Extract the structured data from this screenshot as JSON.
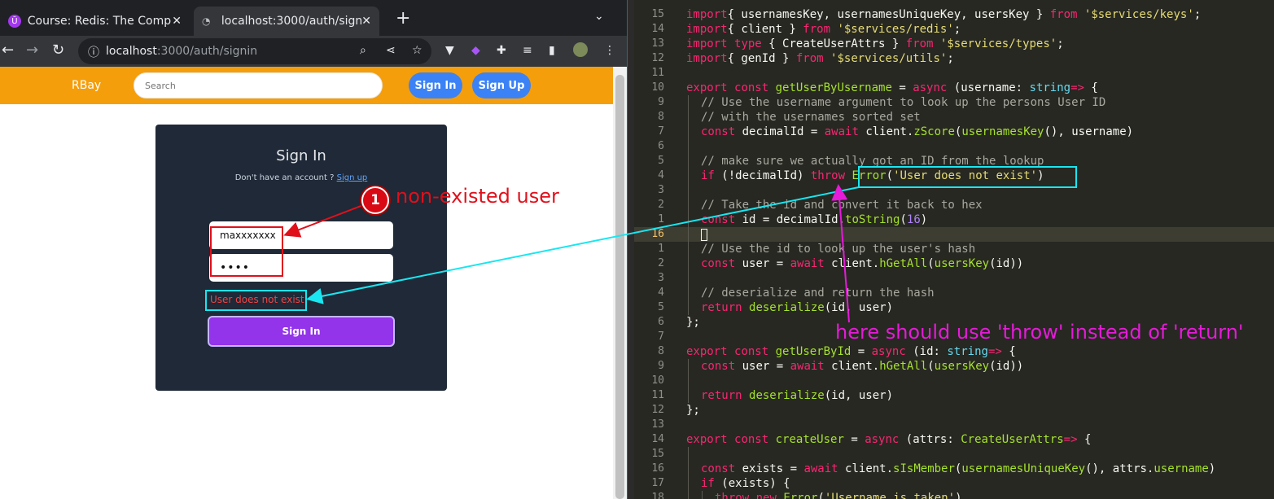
{
  "browser": {
    "tabs": [
      {
        "title": "Course: Redis: The Compl",
        "favicon": "udemy-icon"
      },
      {
        "title": "localhost:3000/auth/sign",
        "favicon": "page-icon"
      }
    ],
    "address": {
      "host": "localhost",
      "path": ":3000/auth/signin"
    }
  },
  "app": {
    "brand": "RBay",
    "search_placeholder": "Search",
    "nav_signin": "Sign In",
    "nav_signup": "Sign Up",
    "form": {
      "title": "Sign In",
      "subtitle": "Don't have an account ?",
      "subtitle_link": "Sign up",
      "username_value": "maxxxxxxx",
      "password_value": "••••",
      "error": "User does not exist",
      "submit_label": "Sign In"
    }
  },
  "editor": {
    "current_line": 16,
    "lines": [
      {
        "n": "15",
        "indent": 0,
        "tokens": [
          [
            "kw",
            "import"
          ],
          [
            "",
            "{ usernamesKey, usernamesUniqueKey, usersKey } "
          ],
          [
            "kw",
            "from"
          ],
          [
            "",
            " "
          ],
          [
            "st",
            "'$services/keys'"
          ],
          [
            "",
            ";"
          ]
        ]
      },
      {
        "n": "14",
        "indent": 0,
        "tokens": [
          [
            "kw",
            "import"
          ],
          [
            "",
            "{ client } "
          ],
          [
            "kw",
            "from"
          ],
          [
            "",
            " "
          ],
          [
            "st",
            "'$services/redis'"
          ],
          [
            "",
            ";"
          ]
        ]
      },
      {
        "n": "13",
        "indent": 0,
        "tokens": [
          [
            "kw",
            "import"
          ],
          [
            "",
            " "
          ],
          [
            "kw",
            "type"
          ],
          [
            "",
            " { "
          ],
          [
            "",
            "CreateUserAttrs"
          ],
          [
            "",
            " } "
          ],
          [
            "kw",
            "from"
          ],
          [
            "",
            " "
          ],
          [
            "st",
            "'$services/types'"
          ],
          [
            "",
            ";"
          ]
        ]
      },
      {
        "n": "12",
        "indent": 0,
        "tokens": [
          [
            "kw",
            "import"
          ],
          [
            "",
            "{ genId } "
          ],
          [
            "kw",
            "from"
          ],
          [
            "",
            " "
          ],
          [
            "st",
            "'$services/utils'"
          ],
          [
            "",
            ";"
          ]
        ]
      },
      {
        "n": "11",
        "indent": 0,
        "tokens": []
      },
      {
        "n": "10",
        "indent": 0,
        "tokens": [
          [
            "kw",
            "export"
          ],
          [
            "",
            " "
          ],
          [
            "kw",
            "const"
          ],
          [
            "",
            " "
          ],
          [
            "fn",
            "getUserByUsername"
          ],
          [
            "",
            " = "
          ],
          [
            "kw",
            "async"
          ],
          [
            "",
            " (username: "
          ],
          [
            "ty",
            "string"
          ],
          [
            ") "
          ],
          [
            "kw",
            "=>"
          ],
          [
            "",
            " {"
          ]
        ]
      },
      {
        "n": "9",
        "indent": 1,
        "tokens": [
          [
            "cm",
            "// Use the username argument to look up the persons User ID"
          ]
        ]
      },
      {
        "n": "8",
        "indent": 1,
        "tokens": [
          [
            "cm",
            "// with the usernames sorted set"
          ]
        ]
      },
      {
        "n": "7",
        "indent": 1,
        "tokens": [
          [
            "kw",
            "const"
          ],
          [
            "",
            " decimalId = "
          ],
          [
            "kw",
            "await"
          ],
          [
            "",
            " client."
          ],
          [
            "fn",
            "zScore"
          ],
          [
            "",
            "("
          ],
          [
            "fn",
            "usernamesKey"
          ],
          [
            "",
            "(), username)"
          ]
        ]
      },
      {
        "n": "6",
        "indent": 1,
        "tokens": []
      },
      {
        "n": "5",
        "indent": 1,
        "tokens": [
          [
            "cm",
            "// make sure we actually got an ID from the lookup"
          ]
        ]
      },
      {
        "n": "4",
        "indent": 1,
        "tokens": [
          [
            "kw",
            "if"
          ],
          [
            "",
            " (!decimalId) "
          ],
          [
            "kw",
            "throw"
          ],
          [
            "",
            " "
          ],
          [
            "fn",
            "Error"
          ],
          [
            "",
            "("
          ],
          [
            "st",
            "'User does not exist'"
          ],
          [
            "",
            ")"
          ]
        ]
      },
      {
        "n": "3",
        "indent": 1,
        "tokens": []
      },
      {
        "n": "2",
        "indent": 1,
        "tokens": [
          [
            "cm",
            "// Take the id and convert it back to hex"
          ]
        ]
      },
      {
        "n": "1",
        "indent": 1,
        "tokens": [
          [
            "kw",
            "const"
          ],
          [
            "",
            " id = decimalId."
          ],
          [
            "fn",
            "toString"
          ],
          [
            "",
            "("
          ],
          [
            "nu",
            "16"
          ],
          [
            "",
            ")"
          ]
        ]
      },
      {
        "n": "16",
        "indent": 1,
        "tokens": []
      },
      {
        "n": "1",
        "indent": 1,
        "tokens": [
          [
            "cm",
            "// Use the id to look up the user's hash"
          ]
        ]
      },
      {
        "n": "2",
        "indent": 1,
        "tokens": [
          [
            "kw",
            "const"
          ],
          [
            "",
            " user = "
          ],
          [
            "kw",
            "await"
          ],
          [
            "",
            " client."
          ],
          [
            "fn",
            "hGetAll"
          ],
          [
            "",
            "("
          ],
          [
            "fn",
            "usersKey"
          ],
          [
            "",
            "(id))"
          ]
        ]
      },
      {
        "n": "3",
        "indent": 1,
        "tokens": []
      },
      {
        "n": "4",
        "indent": 1,
        "tokens": [
          [
            "cm",
            "// deserialize and return the hash"
          ]
        ]
      },
      {
        "n": "5",
        "indent": 1,
        "tokens": [
          [
            "kw",
            "return"
          ],
          [
            "",
            " "
          ],
          [
            "fn",
            "deserialize"
          ],
          [
            "",
            "(id, user)"
          ]
        ]
      },
      {
        "n": "6",
        "indent": 0,
        "tokens": [
          [
            "",
            "};"
          ]
        ]
      },
      {
        "n": "7",
        "indent": 0,
        "tokens": []
      },
      {
        "n": "8",
        "indent": 0,
        "tokens": [
          [
            "kw",
            "export"
          ],
          [
            "",
            " "
          ],
          [
            "kw",
            "const"
          ],
          [
            "",
            " "
          ],
          [
            "fn",
            "getUserById"
          ],
          [
            "",
            " = "
          ],
          [
            "kw",
            "async"
          ],
          [
            "",
            " (id: "
          ],
          [
            "ty",
            "string"
          ],
          [
            ") "
          ],
          [
            "kw",
            "=>"
          ],
          [
            "",
            " {"
          ]
        ]
      },
      {
        "n": "9",
        "indent": 1,
        "tokens": [
          [
            "kw",
            "const"
          ],
          [
            "",
            " user = "
          ],
          [
            "kw",
            "await"
          ],
          [
            "",
            " client."
          ],
          [
            "fn",
            "hGetAll"
          ],
          [
            "",
            "("
          ],
          [
            "fn",
            "usersKey"
          ],
          [
            "",
            "(id))"
          ]
        ]
      },
      {
        "n": "10",
        "indent": 1,
        "tokens": []
      },
      {
        "n": "11",
        "indent": 1,
        "tokens": [
          [
            "kw",
            "return"
          ],
          [
            "",
            " "
          ],
          [
            "fn",
            "deserialize"
          ],
          [
            "",
            "(id, user)"
          ]
        ]
      },
      {
        "n": "12",
        "indent": 0,
        "tokens": [
          [
            "",
            "};"
          ]
        ]
      },
      {
        "n": "13",
        "indent": 0,
        "tokens": []
      },
      {
        "n": "14",
        "indent": 0,
        "tokens": [
          [
            "kw",
            "export"
          ],
          [
            "",
            " "
          ],
          [
            "kw",
            "const"
          ],
          [
            "",
            " "
          ],
          [
            "fn",
            "createUser"
          ],
          [
            "",
            " = "
          ],
          [
            "kw",
            "async"
          ],
          [
            "",
            " (attrs: "
          ],
          [
            "fn",
            "CreateUserAttrs"
          ],
          [
            ") "
          ],
          [
            "kw",
            "=>"
          ],
          [
            "",
            " {"
          ]
        ]
      },
      {
        "n": "15",
        "indent": 1,
        "tokens": []
      },
      {
        "n": "16",
        "indent": 1,
        "tokens": [
          [
            "kw",
            "const"
          ],
          [
            "",
            " exists = "
          ],
          [
            "kw",
            "await"
          ],
          [
            "",
            " client."
          ],
          [
            "fn",
            "sIsMember"
          ],
          [
            "",
            "("
          ],
          [
            "fn",
            "usernamesUniqueKey"
          ],
          [
            "",
            "(), attrs."
          ],
          [
            "fn",
            "username"
          ],
          [
            "",
            ")"
          ]
        ]
      },
      {
        "n": "17",
        "indent": 1,
        "tokens": [
          [
            "kw",
            "if"
          ],
          [
            "",
            " (exists) {"
          ]
        ]
      },
      {
        "n": "18",
        "indent": 2,
        "tokens": [
          [
            "kw",
            "throw"
          ],
          [
            "",
            " "
          ],
          [
            "kw",
            "new"
          ],
          [
            "",
            " "
          ],
          [
            "fn",
            "Error"
          ],
          [
            "",
            "("
          ],
          [
            "st",
            "'Username is taken'"
          ],
          [
            "",
            ")"
          ]
        ]
      }
    ]
  },
  "annotations": {
    "badge_number": "1",
    "nonexist_label": "non-existed user",
    "should_label": "here should use 'throw' instead of 'return'",
    "colors": {
      "red": "#e0101b",
      "cyan": "#19e6f0",
      "magenta": "#e61ad9"
    }
  }
}
